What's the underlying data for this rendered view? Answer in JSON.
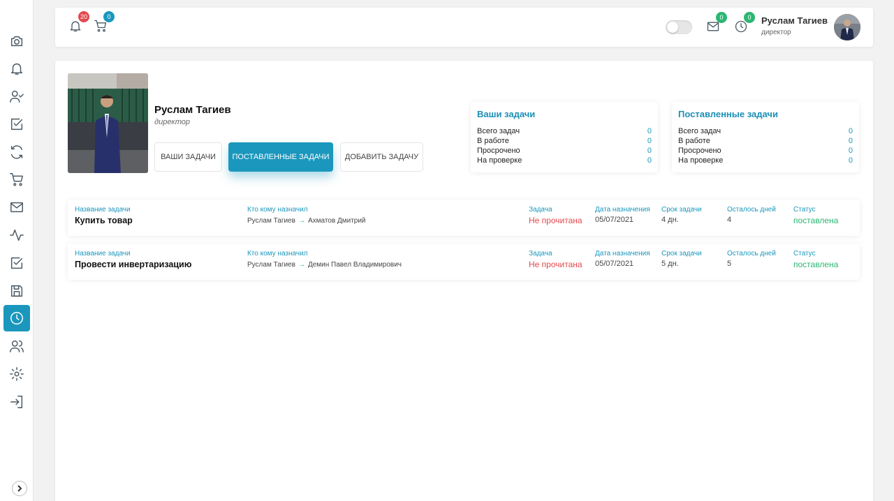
{
  "topbar": {
    "notifications_badge": "20",
    "cart_badge": "0",
    "mail_badge": "0",
    "clock_badge": "0",
    "user_name": "Руслам Тагиев",
    "user_role": "директор"
  },
  "sidebar": {
    "items": [
      {
        "icon": "camera-icon"
      },
      {
        "icon": "bell-icon"
      },
      {
        "icon": "user-check-icon"
      },
      {
        "icon": "checkbox-icon"
      },
      {
        "icon": "refresh-icon"
      },
      {
        "icon": "cart-icon"
      },
      {
        "icon": "mail-icon"
      },
      {
        "icon": "activity-icon"
      },
      {
        "icon": "checkbox-icon"
      },
      {
        "icon": "save-icon"
      },
      {
        "icon": "clock-icon"
      },
      {
        "icon": "users-icon"
      },
      {
        "icon": "settings-icon"
      },
      {
        "icon": "login-icon"
      }
    ],
    "active": "clock-icon"
  },
  "profile": {
    "name": "Руслам Тагиев",
    "role": "директор"
  },
  "buttons": {
    "your_tasks": "Ваши задачи",
    "assigned_tasks": "Поставленные задачи",
    "add_task": "Добавить задачу"
  },
  "your_tasks_card": {
    "title": "Ваши задачи",
    "rows": [
      {
        "label": "Всего задач",
        "value": "0"
      },
      {
        "label": "В работе",
        "value": "0"
      },
      {
        "label": "Просрочено",
        "value": "0"
      },
      {
        "label": "На проверке",
        "value": "0"
      }
    ]
  },
  "assigned_tasks_card": {
    "title": "Поставленные задачи",
    "rows": [
      {
        "label": "Всего задач",
        "value": "0"
      },
      {
        "label": "В работе",
        "value": "0"
      },
      {
        "label": "Просрочено",
        "value": "0"
      },
      {
        "label": "На проверке",
        "value": "0"
      }
    ]
  },
  "task_columns": {
    "name": "Название задачи",
    "who": "Кто кому назначил",
    "task": "Задача",
    "date": "Дата назначения",
    "deadline": "Срок задачи",
    "days_left": "Осталось дней",
    "status": "Статус"
  },
  "tasks": [
    {
      "name": "Купить товар",
      "from": "Руслам Тагиев",
      "to": "Ахматов Дмитрий",
      "task_state": "Не прочитана",
      "date": "05/07/2021",
      "deadline": "4 дн.",
      "days_left": "4",
      "status": "поставлена"
    },
    {
      "name": "Провести инвертаризацию",
      "from": "Руслам Тагиев",
      "to": "Демин Павел Владимирович",
      "task_state": "Не прочитана",
      "date": "05/07/2021",
      "deadline": "5 дн.",
      "days_left": "5",
      "status": "поставлена"
    }
  ],
  "colors": {
    "accent": "#1b97bd",
    "danger": "#e5484d",
    "success": "#2bb673"
  }
}
